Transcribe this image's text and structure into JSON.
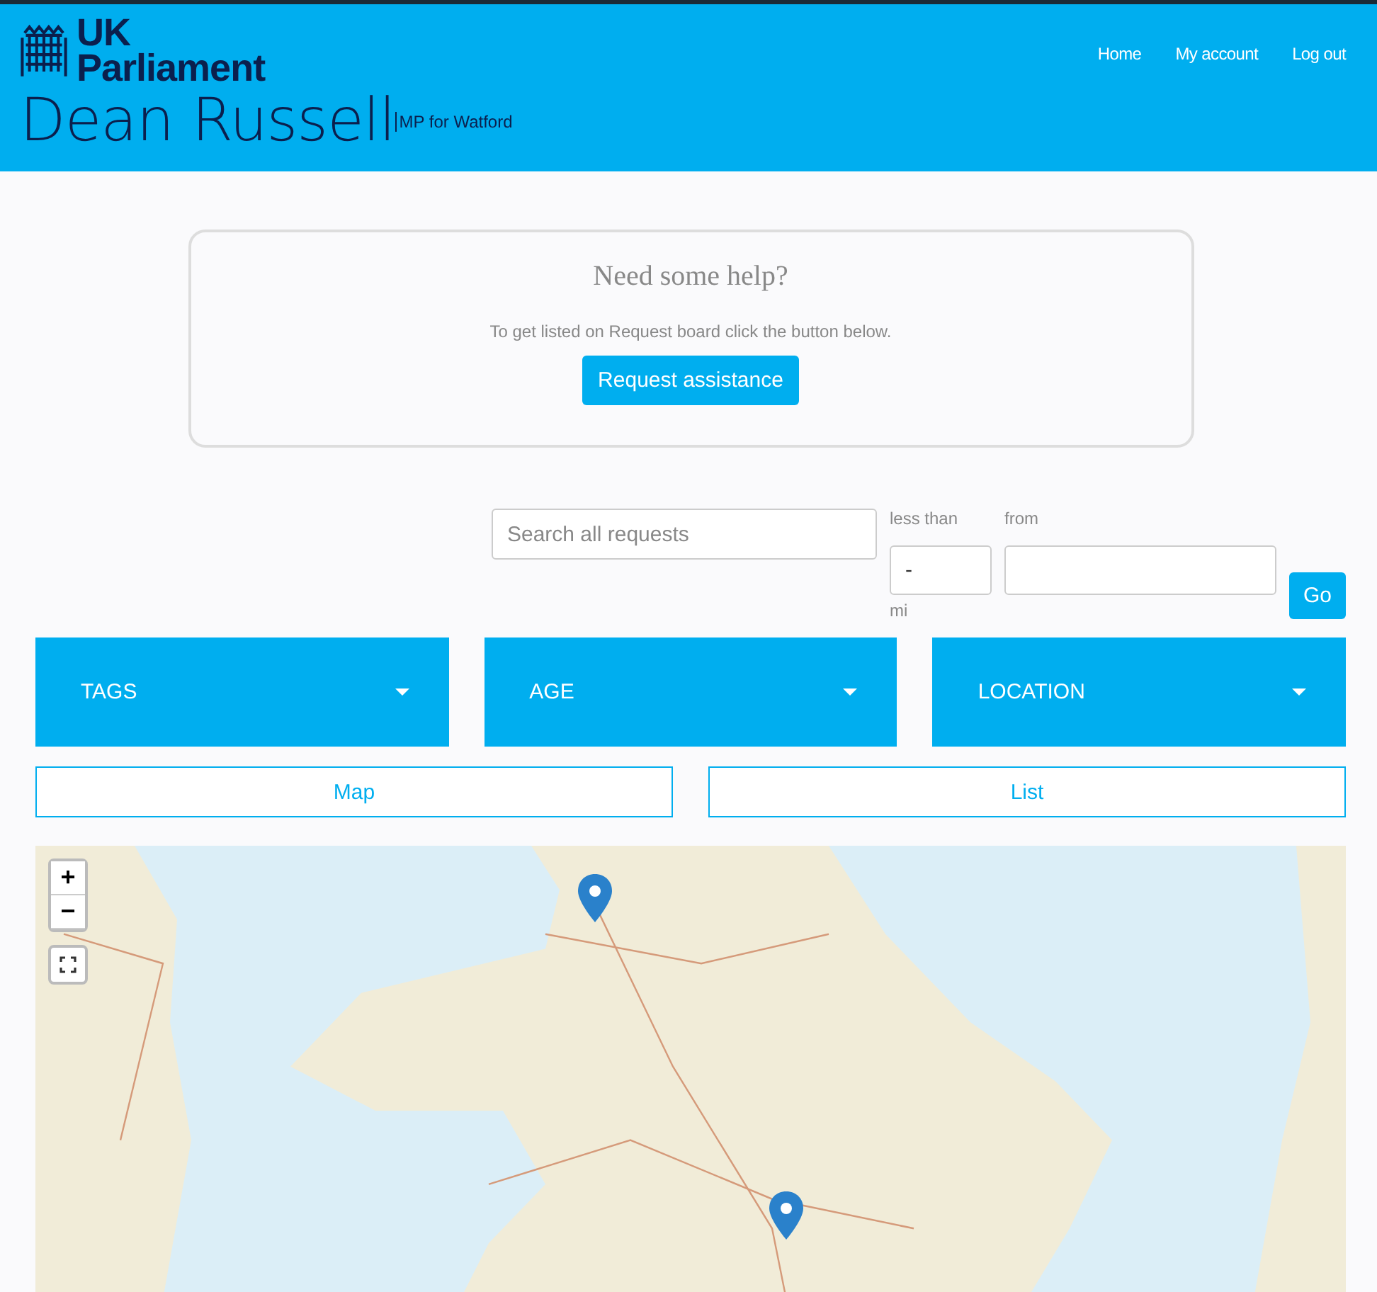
{
  "header": {
    "logo": {
      "line1": "UK",
      "line2": "Parliament"
    },
    "nav": [
      "Home",
      "My account",
      "Log out"
    ],
    "name": "Dean Russell",
    "subtitle": "MP for Watford"
  },
  "help_card": {
    "title": "Need some help?",
    "text": "To get listed on Request board click the button below.",
    "button": "Request assistance"
  },
  "search": {
    "placeholder": "Search all requests",
    "distance_label": "less than",
    "distance_value": "-",
    "unit": "mi",
    "from_label": "from",
    "go": "Go"
  },
  "filters": [
    "TAGS",
    "AGE",
    "LOCATION"
  ],
  "views": [
    "Map",
    "List"
  ],
  "map": {
    "zoom_in": "+",
    "zoom_out": "−"
  }
}
